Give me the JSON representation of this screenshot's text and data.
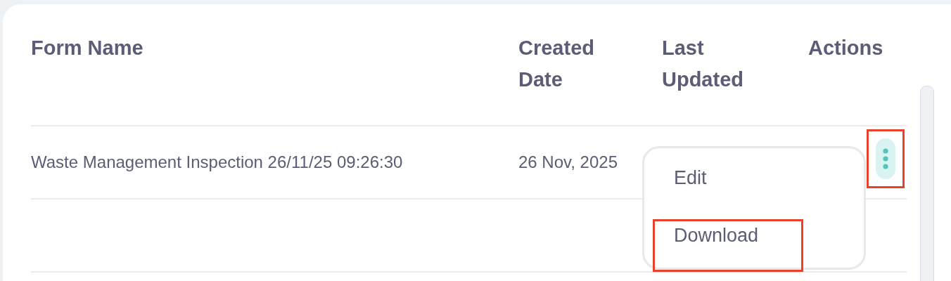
{
  "table": {
    "columns": [
      "Form Name",
      "Created Date",
      "Last Updated",
      "Actions"
    ],
    "rows": [
      {
        "form_name": "Waste Management Inspection 26/11/25 09:26:30",
        "created_date": "26 Nov, 2025",
        "menu_open": true,
        "actions_highlighted": true
      }
    ]
  },
  "menu": {
    "items": [
      {
        "label": "Edit",
        "highlighted": false
      },
      {
        "label": "Download",
        "highlighted": true
      }
    ]
  }
}
